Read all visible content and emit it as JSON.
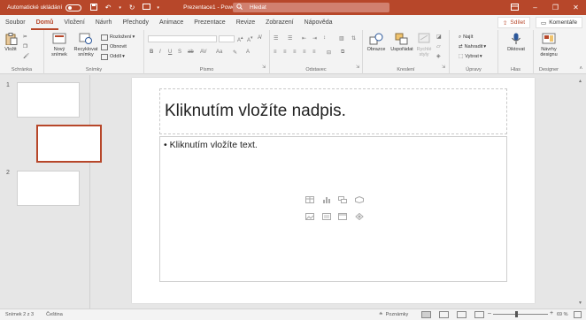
{
  "titlebar": {
    "autosave_label": "Automatické ukládání",
    "doc_title": "Prezentace1  -  PowerPoint",
    "search_placeholder": "Hledat",
    "accent": "#b7472a"
  },
  "tabs": [
    "Soubor",
    "Domů",
    "Vložení",
    "Návrh",
    "Přechody",
    "Animace",
    "Prezentace",
    "Revize",
    "Zobrazení",
    "Nápověda"
  ],
  "active_tab": "Domů",
  "share_label": "Sdílet",
  "comments_label": "Komentáře",
  "ribbon": {
    "clipboard": {
      "label": "Schránka",
      "paste": "Vložit"
    },
    "slides": {
      "label": "Snímky",
      "new_slide": "Nový\nsnímek",
      "reuse": "Recyklovat\nsnímky",
      "layout": "Rozložení",
      "reset": "Obnovit",
      "section": "Oddíl"
    },
    "font": {
      "label": "Písmo"
    },
    "paragraph": {
      "label": "Odstavec"
    },
    "drawing": {
      "label": "Kreslení",
      "shapes": "Obrazce",
      "arrange": "Uspořádat",
      "quick_styles": "Rychlé\nstyly"
    },
    "editing": {
      "label": "Úpravy",
      "find": "Najít",
      "replace": "Nahradit",
      "select": "Vybrat"
    },
    "voice": {
      "label": "Hlas",
      "dictate": "Diktovat"
    },
    "designer": {
      "label": "Designer",
      "ideas": "Návrhy\ndesignu"
    }
  },
  "thumbnails": [
    {
      "number": "1"
    },
    {
      "number": "2"
    }
  ],
  "slide": {
    "title_placeholder": "Kliknutím vložíte nadpis.",
    "body_placeholder": "Kliknutím vložíte text."
  },
  "status": {
    "slide_counter": "Snímek 2 z 3",
    "language": "Čeština",
    "notes": "Poznámky",
    "zoom": "69 %"
  }
}
